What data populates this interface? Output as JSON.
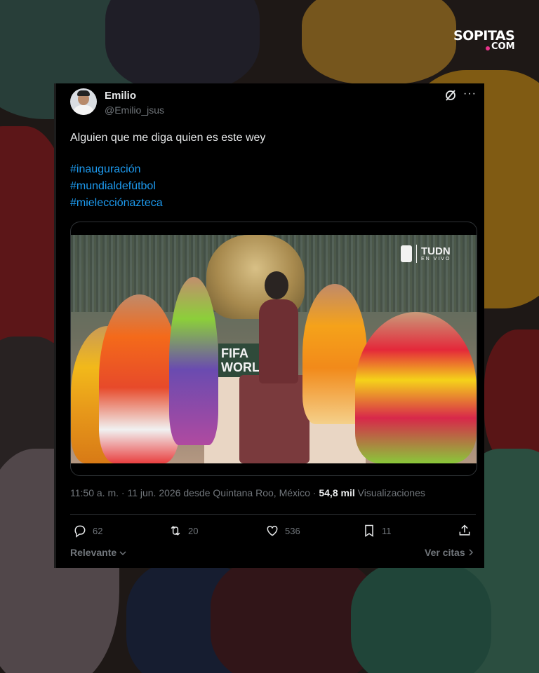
{
  "logo": {
    "main": "SOPITAS",
    "sub": "COM"
  },
  "tweet": {
    "author_name": "Emilio",
    "author_handle": "@Emilio_jsus",
    "text": "Alguien que me diga quien es este wey",
    "hashtags": [
      "#inauguración",
      "#mundialdefútbol",
      "#mielecciónazteca"
    ],
    "media": {
      "watermark": "TUDN",
      "watermark_sub": "EN VIVO",
      "stage_text": "FIFA WORLD"
    },
    "meta": {
      "timestamp": "11:50 a. m. · 11 jun. 2026 desde Quintana Roo, México ·",
      "views_count": "54,8 mil",
      "views_label": "Visualizaciones"
    },
    "actions": {
      "replies": "62",
      "reposts": "20",
      "likes": "536",
      "bookmarks": "11"
    },
    "footer": {
      "sort_label": "Relevante",
      "quotes_label": "Ver citas"
    }
  },
  "colors": {
    "card_bg": "#000000",
    "text_primary": "#e7e9ea",
    "text_secondary": "#71767b",
    "hashtag": "#1d9bf0",
    "logo_accent": "#e8338a"
  },
  "icons": [
    "grok-icon",
    "more-icon",
    "reply-icon",
    "repost-icon",
    "like-icon",
    "bookmark-icon",
    "share-icon",
    "chevron-down-icon",
    "chevron-right-icon"
  ]
}
